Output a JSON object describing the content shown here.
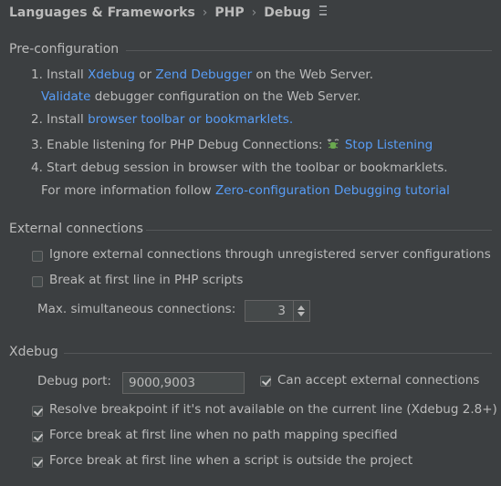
{
  "breadcrumb": {
    "items": [
      "Languages & Frameworks",
      "PHP",
      "Debug"
    ]
  },
  "preconfig": {
    "title": "Pre-configuration",
    "step1": {
      "prefix": "1. Install ",
      "xdebug": "Xdebug",
      "or": " or ",
      "zend": "Zend Debugger",
      "suffix": " on the Web Server."
    },
    "step1b": {
      "validate": "Validate",
      "suffix": " debugger configuration on the Web Server."
    },
    "step2": {
      "prefix": "2. Install ",
      "link": "browser toolbar or bookmarklets."
    },
    "step3": {
      "prefix": "3. Enable listening for PHP Debug Connections: ",
      "link": "Stop Listening"
    },
    "step4": "4. Start debug session in browser with the toolbar or bookmarklets.",
    "step4b": {
      "prefix": "For more information follow ",
      "link": "Zero-configuration Debugging tutorial"
    }
  },
  "external": {
    "title": "External connections",
    "ignore_label": "Ignore external connections through unregistered server configurations",
    "ignore_checked": false,
    "break_label": "Break at first line in PHP scripts",
    "break_checked": false,
    "max_label": "Max. simultaneous connections:",
    "max_value": "3"
  },
  "xdebug": {
    "title": "Xdebug",
    "port_label": "Debug port:",
    "port_value": "9000,9003",
    "accept_label": "Can accept external connections",
    "accept_checked": true,
    "resolve_label": "Resolve breakpoint if it's not available on the current line (Xdebug 2.8+)",
    "resolve_checked": true,
    "force_nomap_label": "Force break at first line when no path mapping specified",
    "force_nomap_checked": true,
    "force_outside_label": "Force break at first line when a script is outside the project",
    "force_outside_checked": true
  },
  "colors": {
    "background": "#3c3f41",
    "text": "#bbbbbb",
    "link": "#589df6",
    "bug_icon": "#6aa84f"
  }
}
